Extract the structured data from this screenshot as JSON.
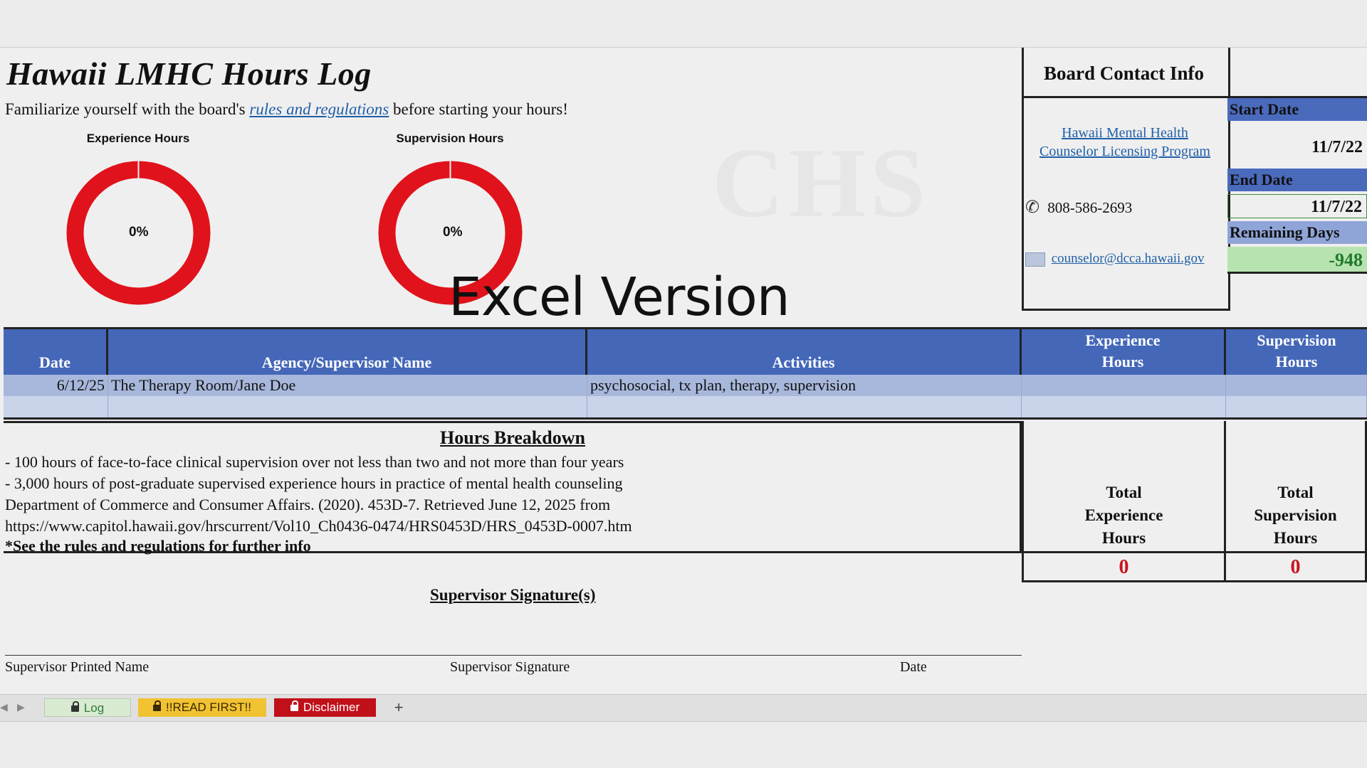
{
  "sheet": {
    "title": "Hawaii LMHC Hours Log",
    "intro_before": "Familiarize yourself with the board's",
    "intro_link": "rules and regulations",
    "intro_after": "before starting your hours!",
    "watermark": "CHS",
    "overlay_text": "Excel Version"
  },
  "charts": {
    "experience": {
      "label": "Experience Hours",
      "percent_text": "0%",
      "value": 0
    },
    "supervision": {
      "label": "Supervision Hours",
      "percent_text": "0%",
      "value": 0
    }
  },
  "contact": {
    "heading": "Board Contact Info",
    "program_line1": "Hawaii Mental Health",
    "program_line2": "Counselor Licensing Program",
    "phone": "808-586-2693",
    "email": "counselor@dcca.hawaii.gov",
    "phone_icon": "phone-icon",
    "email_icon": "envelope-icon"
  },
  "dates": {
    "start_label": "Start Date",
    "start_value": "11/7/22",
    "end_label": "End Date",
    "end_value": "11/7/22",
    "remaining_label": "Remaining Days",
    "remaining_value": "-948"
  },
  "table": {
    "headers": {
      "date": "Date",
      "agency": "Agency/Supervisor Name",
      "activities": "Activities",
      "exp1": "Experience",
      "exp2": "Hours",
      "sup1": "Supervision",
      "sup2": "Hours"
    },
    "rows": [
      {
        "date": "6/12/25",
        "agency": "The Therapy Room/Jane Doe",
        "activities": "psychosocial, tx plan, therapy, supervision",
        "exp": "",
        "sup": ""
      },
      {
        "date": "",
        "agency": "",
        "activities": "",
        "exp": "",
        "sup": ""
      }
    ]
  },
  "breakdown": {
    "title": "Hours Breakdown",
    "line1": "- 100 hours of face-to-face clinical supervision over not less than two and not more than four years",
    "line2": "- 3,000 hours of post-graduate supervised experience hours in practice of mental health counseling",
    "line3": "Department of Commerce and Consumer Affairs. (2020). 453D-7. Retrieved June 12, 2025 from",
    "line4": "https://www.capitol.hawaii.gov/hrscurrent/Vol10_Ch0436-0474/HRS0453D/HRS_0453D-0007.htm",
    "line5": "*See the rules and regulations for further info"
  },
  "totals": {
    "exp_l1": "Total",
    "exp_l2": "Experience",
    "exp_l3": "Hours",
    "exp_value": "0",
    "sup_l1": "Total",
    "sup_l2": "Supervision",
    "sup_l3": "Hours",
    "sup_value": "0"
  },
  "signature": {
    "title": "Supervisor Signature(s)",
    "printed_name": "Supervisor Printed Name",
    "signature": "Supervisor Signature",
    "date": "Date"
  },
  "tabs": [
    {
      "label": "Log",
      "bg": "#d9ead3",
      "color": "#2e7d32"
    },
    {
      "label": "!!READ FIRST!!",
      "bg": "#f1c232",
      "color": "#3a2a00"
    },
    {
      "label": "Disclaimer",
      "bg": "#c0101a",
      "color": "#ffffff"
    }
  ],
  "tabbar": {
    "add_label": "+"
  },
  "colors": {
    "header_blue": "#4467b8",
    "row_blue": "#a8b8dc",
    "donut_red": "#e0121b",
    "remaining_green": "#b6e3b0"
  }
}
